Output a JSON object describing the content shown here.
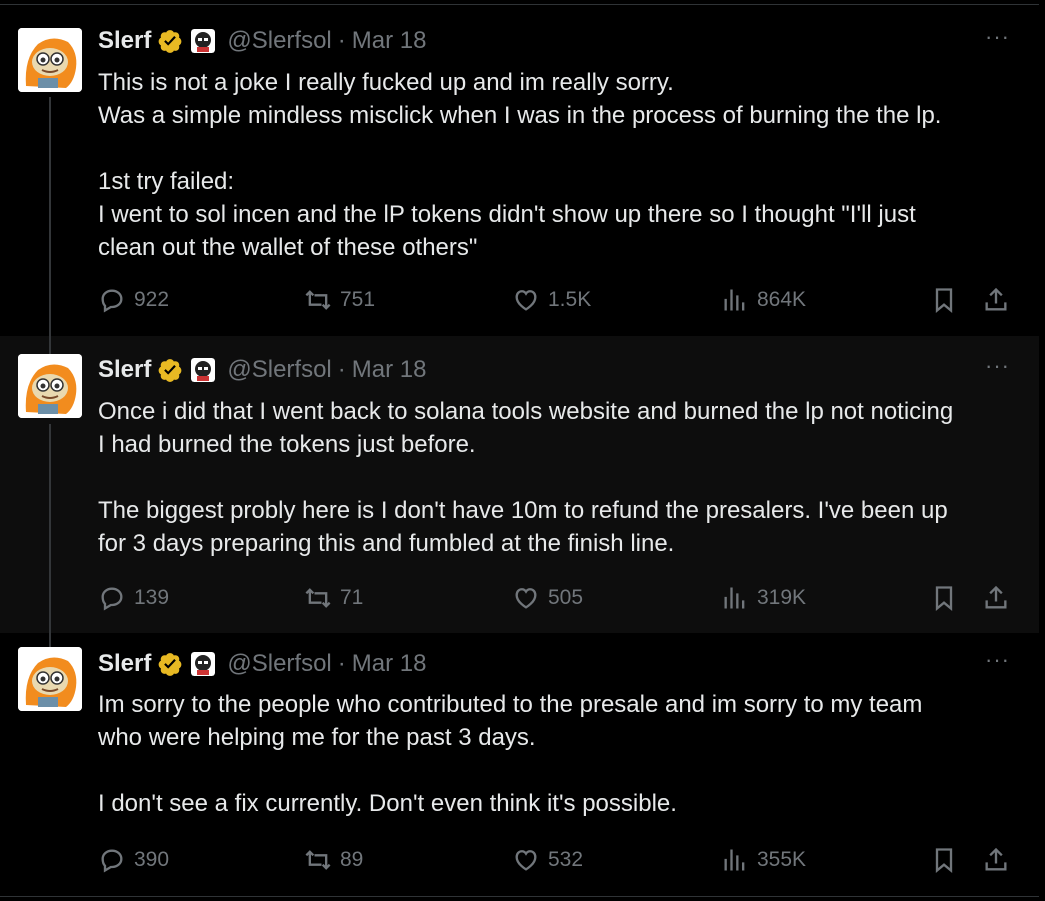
{
  "tweets": [
    {
      "author": {
        "name": "Slerf",
        "handle": "@Slerfsol",
        "verified": "gold-check-icon",
        "affiliate": "affiliate-badge-icon"
      },
      "separator": "·",
      "date": "Mar 18",
      "text_paragraphs": [
        "This is not a joke I really fucked up and im really sorry.",
        "Was a simple mindless misclick when I was in the process of burning the the lp.",
        "",
        "1st try failed:",
        "I went to sol incen and the lP tokens didn't show up there so I thought \"I'll just",
        "clean out the wallet of these others\""
      ],
      "metrics": {
        "replies": "922",
        "reposts": "751",
        "likes": "1.5K",
        "views": "864K"
      }
    },
    {
      "author": {
        "name": "Slerf",
        "handle": "@Slerfsol",
        "verified": "gold-check-icon",
        "affiliate": "affiliate-badge-icon"
      },
      "separator": "·",
      "date": "Mar 18",
      "text_paragraphs": [
        "Once i did that I went back to solana tools website and burned the lp not noticing",
        "I had burned the tokens just before.",
        "",
        "The biggest probly here is I don't have 10m to refund the presalers. I've been up",
        "for 3 days preparing this and fumbled at the finish line."
      ],
      "metrics": {
        "replies": "139",
        "reposts": "71",
        "likes": "505",
        "views": "319K"
      }
    },
    {
      "author": {
        "name": "Slerf",
        "handle": "@Slerfsol",
        "verified": "gold-check-icon",
        "affiliate": "affiliate-badge-icon"
      },
      "separator": "·",
      "date": "Mar 18",
      "text_paragraphs": [
        "Im sorry to the people who contributed to the presale and im sorry to my team",
        "who were helping me for the past 3 days.",
        "",
        "I don't see a fix currently. Don't even think it's possible."
      ],
      "metrics": {
        "replies": "390",
        "reposts": "89",
        "likes": "532",
        "views": "355K"
      }
    }
  ],
  "more_label": "···",
  "colors": {
    "background": "#000000",
    "text": "#e7e9ea",
    "muted": "#71767b",
    "verified": "#e8b923",
    "avatar_orange": "#f28c1e"
  }
}
